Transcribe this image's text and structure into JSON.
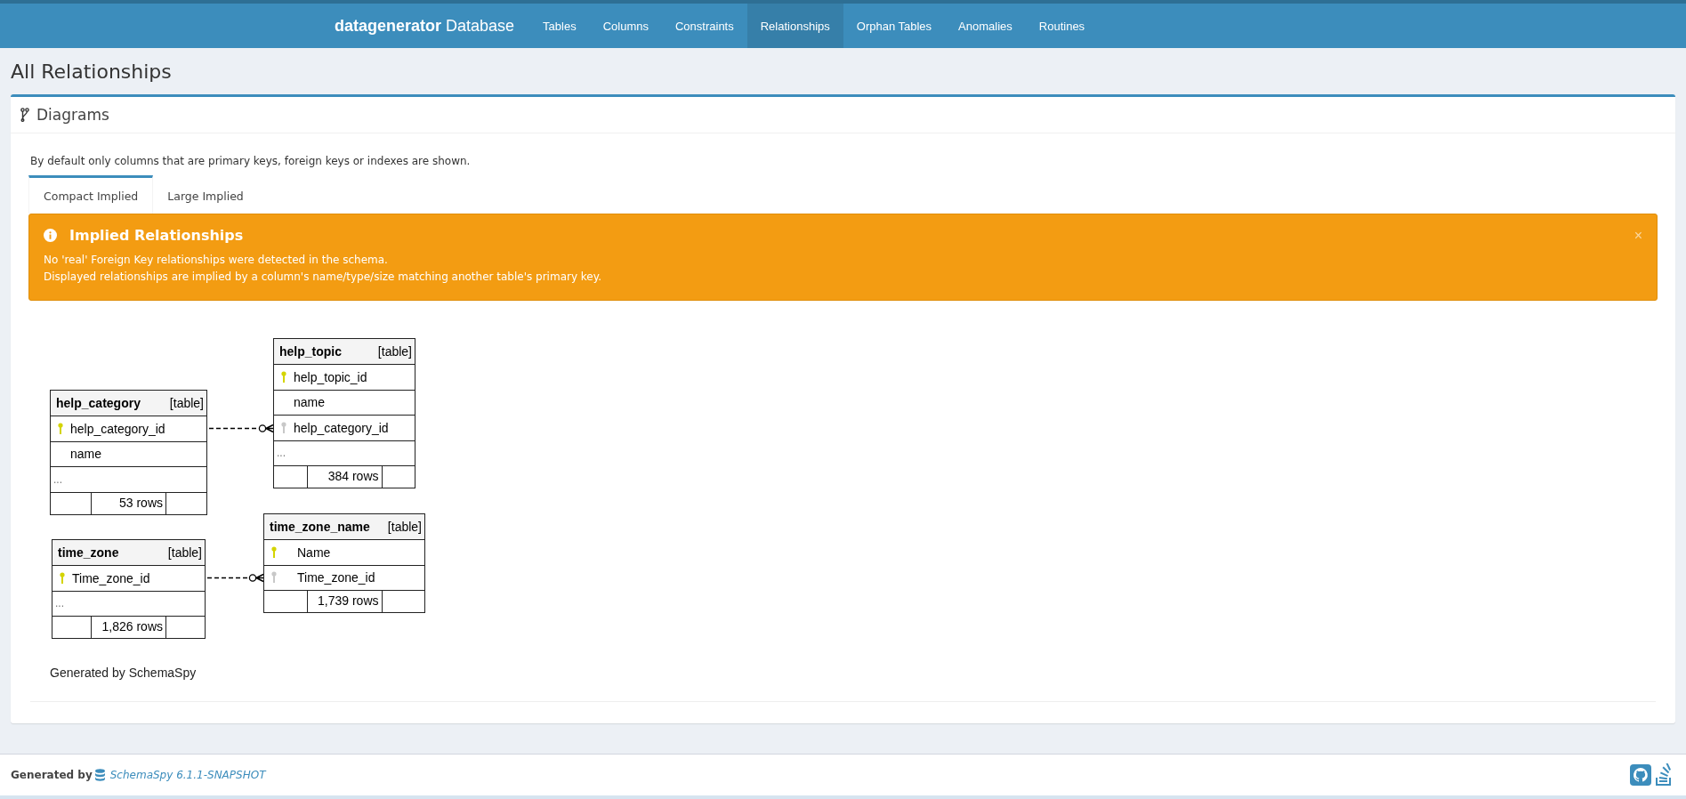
{
  "navbar": {
    "brand": "datagenerator",
    "brand_suffix": "Database",
    "items": [
      {
        "label": "Tables",
        "selected": false
      },
      {
        "label": "Columns",
        "selected": false
      },
      {
        "label": "Constraints",
        "selected": false
      },
      {
        "label": "Relationships",
        "selected": true
      },
      {
        "label": "Orphan Tables",
        "selected": false
      },
      {
        "label": "Anomalies",
        "selected": false
      },
      {
        "label": "Routines",
        "selected": false
      }
    ]
  },
  "page_title": "All Relationships",
  "panel": {
    "title": "Diagrams",
    "description": "By default only columns that are primary keys, foreign keys or indexes are shown.",
    "tabs": [
      {
        "label": "Compact Implied",
        "selected": true
      },
      {
        "label": "Large Implied",
        "selected": false
      }
    ],
    "alert": {
      "title": "Implied Relationships",
      "close": "×",
      "lines": [
        "No 'real' Foreign Key relationships were detected in the schema.",
        "Displayed relationships are implied by a column's name/type/size matching another table's primary key."
      ]
    },
    "diagram": {
      "tables": [
        {
          "name": "help_category",
          "type": "[table]",
          "columns": [
            {
              "name": "help_category_id",
              "kind": "pk"
            },
            {
              "name": "name",
              "kind": "plain"
            }
          ],
          "more": "...",
          "rows": "53 rows"
        },
        {
          "name": "help_topic",
          "type": "[table]",
          "columns": [
            {
              "name": "help_topic_id",
              "kind": "pk"
            },
            {
              "name": "name",
              "kind": "plain"
            },
            {
              "name": "help_category_id",
              "kind": "fk"
            }
          ],
          "more": "...",
          "rows": "384 rows"
        },
        {
          "name": "time_zone",
          "type": "[table]",
          "columns": [
            {
              "name": "Time_zone_id",
              "kind": "pk"
            }
          ],
          "more": "...",
          "rows": "1,826 rows"
        },
        {
          "name": "time_zone_name",
          "type": "[table]",
          "columns": [
            {
              "name": "Name",
              "kind": "pk"
            },
            {
              "name": "Time_zone_id",
              "kind": "fk"
            }
          ],
          "rows": "1,739 rows"
        }
      ],
      "caption": "Generated by SchemaSpy"
    }
  },
  "footer": {
    "generated_by": "Generated by",
    "product": "SchemaSpy 6.1.1-SNAPSHOT"
  }
}
